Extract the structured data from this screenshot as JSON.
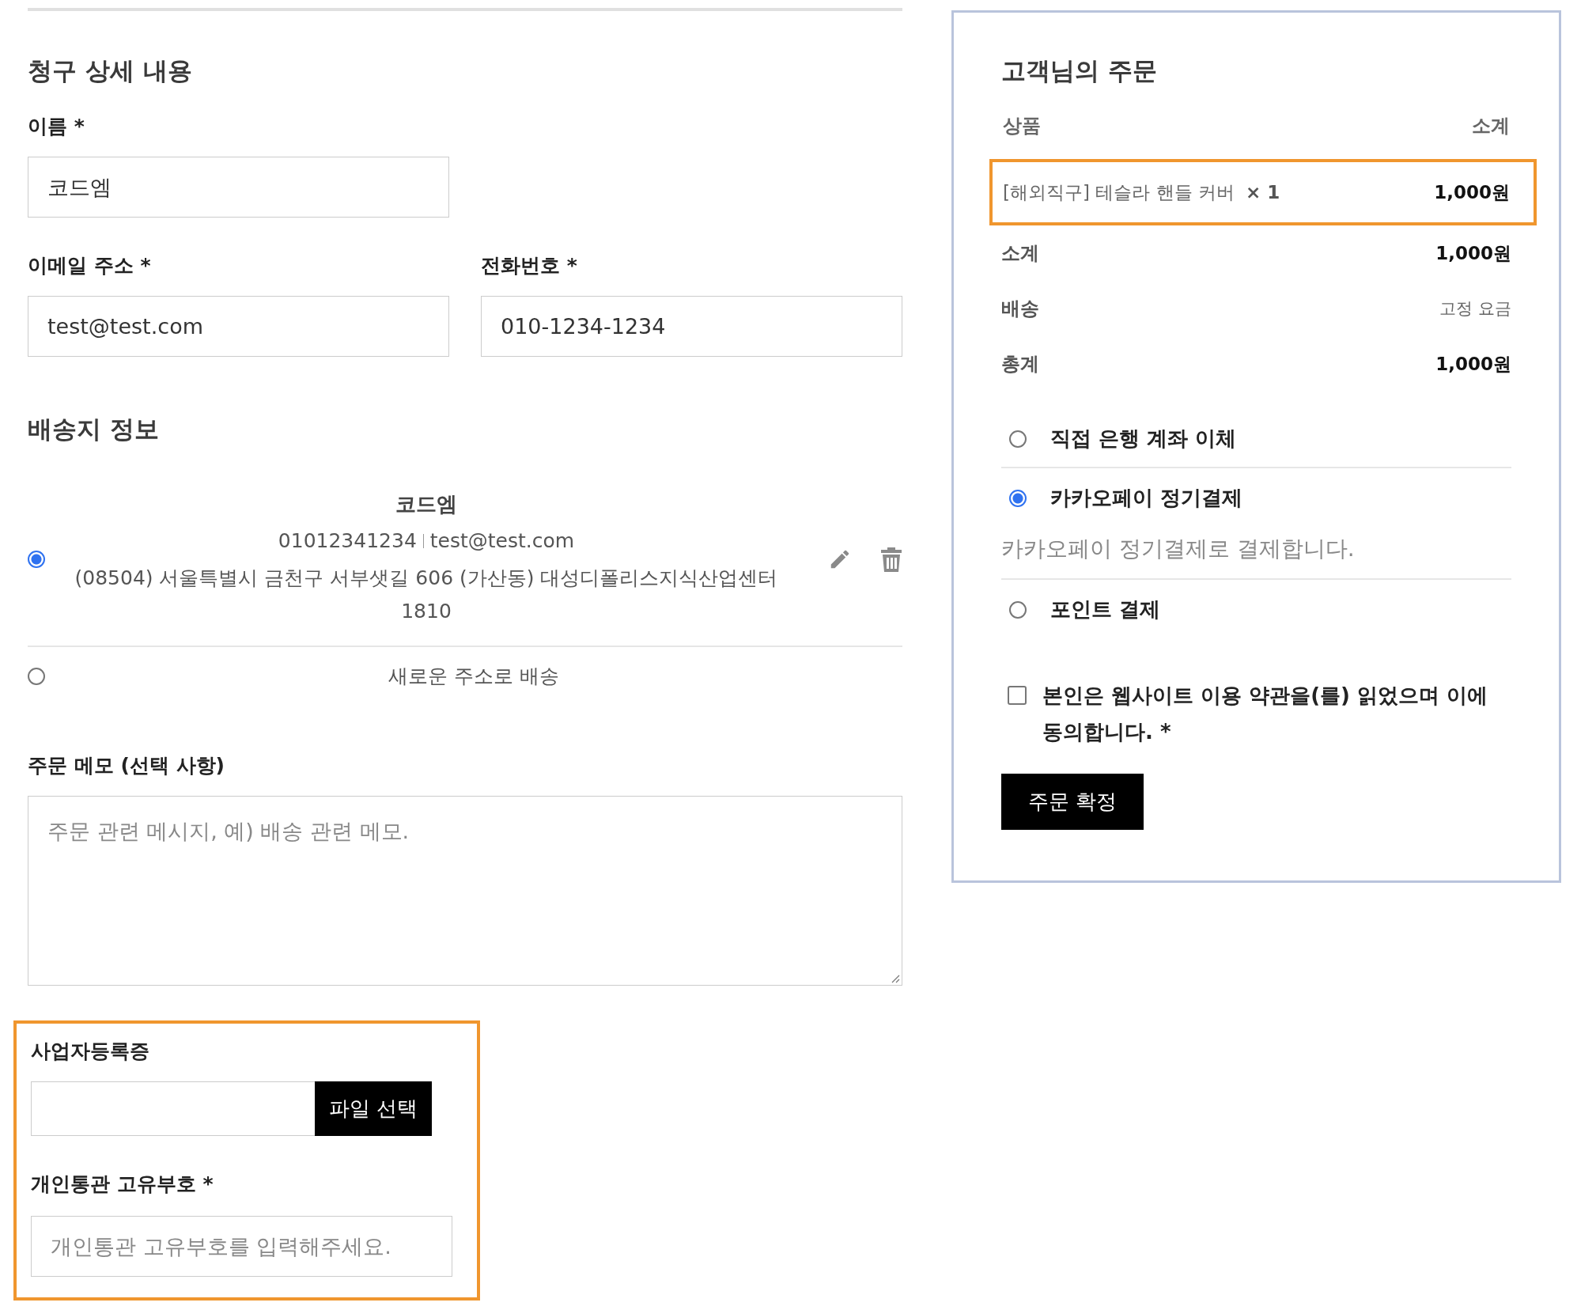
{
  "billing": {
    "heading": "청구 상세 내용",
    "name_field": {
      "label": "이름 *",
      "value": "코드엠"
    },
    "email_field": {
      "label": "이메일 주소 *",
      "value": "test@test.com"
    },
    "phone_field": {
      "label": "전화번호 *",
      "value": "010-1234-1234"
    }
  },
  "shipping": {
    "heading": "배송지 정보",
    "options": [
      {
        "kind": "saved",
        "selected": true,
        "name": "코드엠",
        "phone": "01012341234",
        "email": "test@test.com",
        "address": "(08504) 서울특별시 금천구 서부샛길 606 (가산동) 대성디폴리스지식산업센터 1810"
      },
      {
        "kind": "new",
        "selected": false,
        "label": "새로운 주소로 배송"
      }
    ]
  },
  "order_notes": {
    "label": "주문 메모 (선택 사항)",
    "placeholder": "주문 관련 메시지, 예) 배송 관련 메모."
  },
  "business": {
    "highlighted": true,
    "file_label": "사업자등록증",
    "file_button": "파일 선택",
    "customs_label": "개인통관 고유부호 *",
    "customs_placeholder": "개인통관 고유부호를 입력해주세요."
  },
  "order": {
    "heading": "고객님의 주문",
    "columns": [
      "상품",
      "소계"
    ],
    "item": {
      "highlighted": true,
      "name": "[해외직구] 테슬라 핸들 커버",
      "qty": "× 1",
      "price": "1,000원"
    },
    "totals": [
      {
        "kind": "amount",
        "label": "소계",
        "value": "1,000원"
      },
      {
        "kind": "note",
        "label": "배송",
        "value": "고정 요금"
      },
      {
        "kind": "amount",
        "label": "총계",
        "value": "1,000원"
      }
    ],
    "payment_methods": [
      {
        "label": "직접 은행 계좌 이체",
        "selected": false
      },
      {
        "label": "카카오페이 정기결제",
        "selected": true,
        "description": "카카오페이 정기결제로 결제합니다."
      },
      {
        "label": "포인트 결제",
        "selected": false
      }
    ],
    "terms": {
      "checked": false,
      "text": "본인은 웹사이트 이용 약관을(를) 읽었으며 이에 동의합니다. *"
    },
    "submit": "주문 확정"
  }
}
